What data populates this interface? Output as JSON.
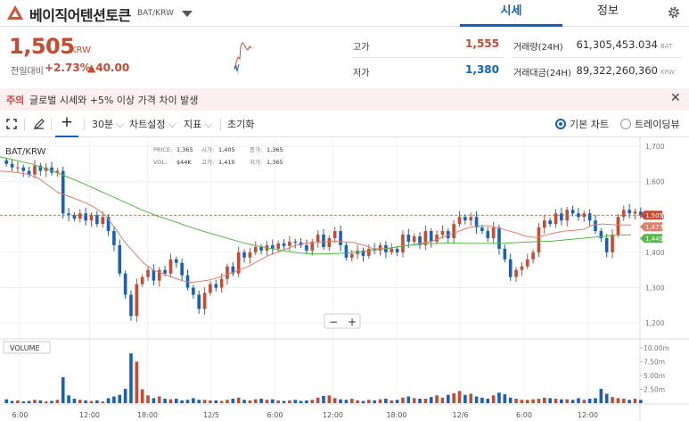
{
  "header": {
    "coin_name": "베이직어텐션토큰",
    "pair": "BAT/KRW",
    "tabs": [
      {
        "label": "시세",
        "active": true
      },
      {
        "label": "정보",
        "active": false
      }
    ],
    "settings_icon": "gear-icon"
  },
  "summary": {
    "price": "1,505",
    "unit": "KRW",
    "change_label": "전일대비",
    "change_pct": "+2.73%",
    "change_abs": "▲40.00",
    "high_label": "고가",
    "high": "1,555",
    "low_label": "저가",
    "low": "1,380",
    "volume_label": "거래량(24H)",
    "volume": "61,305,453.034",
    "volume_unit": "BAT",
    "amount_label": "거래대금(24H)",
    "amount": "89,322,260,360",
    "amount_unit": "KRW"
  },
  "notice": {
    "tag": "주의",
    "message": "글로벌 시세와 +5% 이상 가격 차이 발생"
  },
  "toolbar": {
    "interval": "30분",
    "chart_settings": "차트설정",
    "indicators": "지표",
    "reset": "초기화",
    "basic_chart": "기본 차트",
    "tradingview": "트레이딩뷰",
    "selected_chart": "기본 차트"
  },
  "colors": {
    "up": "#c84a31",
    "down": "#1261c4",
    "accent": "#1261c4",
    "ma_short": "#e0806b",
    "ma_long": "#57b84a"
  },
  "chart_data": {
    "type": "candlestick",
    "symbol": "BAT/KRW",
    "ohlc_readout": {
      "PRICE": "1,365",
      "시가": "1,405",
      "종가": "1,365",
      "VOL": "$44K",
      "고가": "1,410",
      "저가": "1,365"
    },
    "x_ticks": [
      "6:00",
      "12:00",
      "18:00",
      "12/5",
      "6:00",
      "12:00",
      "18:00",
      "12/6",
      "6:00",
      "12:00"
    ],
    "y_ticks": [
      1200,
      1300,
      1400,
      1500,
      1600,
      1700
    ],
    "y_tick_labels": [
      "1,200",
      "1,300",
      "1,400",
      "1,500",
      "1,600",
      "1,700"
    ],
    "ylim": [
      1160,
      1720
    ],
    "price_labels": [
      {
        "text": "1,505",
        "value": 1505,
        "color": "#c84a31"
      },
      {
        "text": "1,477",
        "value": 1477,
        "color": "#e0806b"
      },
      {
        "text": "1,449.6",
        "value": 1449.6,
        "color": "#57b84a"
      }
    ],
    "volume_pane_label": "VOLUME",
    "volume_ticks": [
      "10.00m",
      "7.50m",
      "5.00m",
      "2.50m"
    ],
    "volume_tick_values": [
      10,
      7.5,
      5,
      2.5
    ],
    "volume_max": 10,
    "zoom_out": "−",
    "zoom_in": "+",
    "closes": [
      1650,
      1640,
      1640,
      1630,
      1620,
      1645,
      1630,
      1640,
      1625,
      1630,
      1510,
      1505,
      1495,
      1510,
      1490,
      1505,
      1480,
      1500,
      1460,
      1420,
      1340,
      1280,
      1220,
      1310,
      1330,
      1350,
      1320,
      1350,
      1340,
      1380,
      1370,
      1335,
      1300,
      1280,
      1240,
      1285,
      1310,
      1300,
      1325,
      1360,
      1340,
      1400,
      1385,
      1400,
      1415,
      1405,
      1420,
      1410,
      1425,
      1418,
      1430,
      1428,
      1420,
      1405,
      1430,
      1450,
      1415,
      1440,
      1460,
      1420,
      1385,
      1395,
      1405,
      1390,
      1410,
      1405,
      1420,
      1400,
      1410,
      1400,
      1450,
      1430,
      1445,
      1420,
      1460,
      1430,
      1450,
      1460,
      1440,
      1480,
      1500,
      1490,
      1500,
      1470,
      1460,
      1440,
      1470,
      1410,
      1380,
      1330,
      1350,
      1360,
      1380,
      1400,
      1470,
      1490,
      1480,
      1510,
      1490,
      1520,
      1510,
      1500,
      1510,
      1490,
      1460,
      1440,
      1400,
      1450,
      1500,
      1520,
      1510,
      1515,
      1505
    ],
    "volumes": [
      0.7,
      0.4,
      0.5,
      0.3,
      0.4,
      0.6,
      0.5,
      0.3,
      0.4,
      0.6,
      4.7,
      1.4,
      0.8,
      0.6,
      0.5,
      0.4,
      0.5,
      0.3,
      0.9,
      1.2,
      1.5,
      2.6,
      9.0,
      7.5,
      2.5,
      1.4,
      0.9,
      1.2,
      0.8,
      0.7,
      0.8,
      0.5,
      0.6,
      0.9,
      0.6,
      0.6,
      0.5,
      0.5,
      0.4,
      0.6,
      0.8,
      1.0,
      0.6,
      0.5,
      0.7,
      0.8,
      0.6,
      0.7,
      0.5,
      0.4,
      0.5,
      0.6,
      0.4,
      0.5,
      0.6,
      1.0,
      1.3,
      1.4,
      0.9,
      0.7,
      0.6,
      0.8,
      0.5,
      0.4,
      0.6,
      0.5,
      0.7,
      0.8,
      0.5,
      0.6,
      1.0,
      1.2,
      0.9,
      0.8,
      0.8,
      1.1,
      1.4,
      1.0,
      1.5,
      1.8,
      2.2,
      1.5,
      1.7,
      1.2,
      1.0,
      0.8,
      1.4,
      1.9,
      1.6,
      1.0,
      0.8,
      0.6,
      0.6,
      0.7,
      0.8,
      1.0,
      0.9,
      0.8,
      0.7,
      0.7,
      0.6,
      0.9,
      0.6,
      0.8,
      0.9,
      2.6,
      1.7,
      1.1,
      0.9,
      0.8,
      0.6,
      0.8,
      0.6
    ],
    "ma_short": [
      1630,
      1628,
      1625,
      1620,
      1610,
      1590,
      1570,
      1560,
      1550,
      1540,
      1525,
      1505,
      1470,
      1430,
      1400,
      1370,
      1350,
      1340,
      1330,
      1320,
      1315,
      1318,
      1322,
      1330,
      1340,
      1350,
      1360,
      1375,
      1390,
      1400,
      1410,
      1420,
      1425,
      1428,
      1430,
      1432,
      1430,
      1428,
      1420,
      1410,
      1410,
      1412,
      1418,
      1420,
      1425,
      1430,
      1440,
      1450,
      1460,
      1470,
      1474,
      1475,
      1470,
      1462,
      1455,
      1445,
      1442,
      1448,
      1455,
      1460,
      1462,
      1465,
      1477,
      1480,
      1478,
      1477,
      1477
    ],
    "ma_long": [
      1670,
      1660,
      1650,
      1635,
      1618,
      1600,
      1580,
      1560,
      1540,
      1520,
      1502,
      1488,
      1472,
      1458,
      1445,
      1432,
      1420,
      1412,
      1404,
      1398,
      1395,
      1396,
      1398,
      1402,
      1408,
      1414,
      1420,
      1424,
      1426,
      1426,
      1425,
      1425,
      1426,
      1428,
      1430,
      1432,
      1436,
      1440,
      1444,
      1448,
      1449.6
    ]
  }
}
